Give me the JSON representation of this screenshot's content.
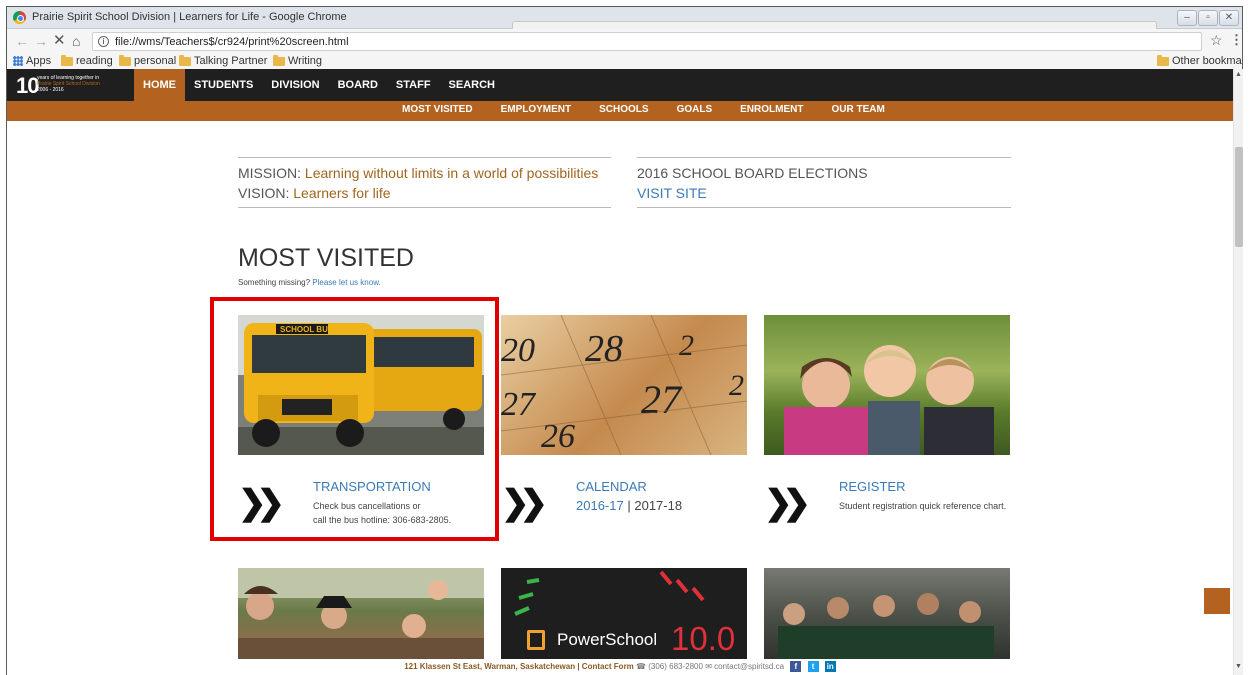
{
  "window": {
    "title": "Prairie Spirit School Division | Learners for Life - Google Chrome",
    "controls": {
      "minimize": "–",
      "maximize": "▫",
      "close": "✕"
    }
  },
  "toolbar": {
    "back": "←",
    "forward": "→",
    "reload": "✕",
    "home": "⌂",
    "url": "file://wms/Teachers$/cr924/print%20screen.html",
    "info": "i",
    "star": "☆",
    "menu": "⋮"
  },
  "bookmarks": {
    "items": [
      "Apps",
      "reading",
      "personal",
      "Talking Partner",
      "Writing"
    ],
    "other": "Other bookmarks"
  },
  "site": {
    "logo_number": "10",
    "logo_tagline": "years of learning together in",
    "logo_org": "Prairie Spirit School Division",
    "logo_years": "2006 - 2016",
    "main_nav": [
      "HOME",
      "STUDENTS",
      "DIVISION",
      "BOARD",
      "STAFF",
      "SEARCH"
    ],
    "sub_nav": [
      "MOST VISITED",
      "EMPLOYMENT",
      "SCHOOLS",
      "GOALS",
      "ENROLMENT",
      "OUR TEAM"
    ],
    "mission_label": "MISSION:",
    "mission_text": "Learning without limits in a world of possibilities",
    "vision_label": "VISION:",
    "vision_text": "Learners for life",
    "election_title": "2016 SCHOOL BOARD ELECTIONS",
    "election_link": "VISIT SITE",
    "most_visited_title": "MOST VISITED",
    "missing_text": "Something missing?",
    "missing_link": "Please let us know.",
    "arrow": "❯❯",
    "cards": {
      "transportation": {
        "title": "TRANSPORTATION",
        "line1": "Check bus cancellations or",
        "line2": "call the bus hotline: 306-683-2805."
      },
      "calendar": {
        "title": "CALENDAR",
        "link1": "2016-17",
        "sep": "|",
        "link2": "2017-18"
      },
      "register": {
        "title": "REGISTER",
        "desc": "Student registration quick reference chart."
      }
    },
    "powerschool_text": "PowerSchool",
    "powerschool_version": "10.0",
    "footer": {
      "address": "121 Klassen St East, Warman, Saskatchewan | Contact Form",
      "phone_icon": "☎",
      "phone": "(306) 683-2800",
      "mail_icon": "✉",
      "email": "contact@spiritsd.ca",
      "fb": "f",
      "tw": "t",
      "li": "in"
    }
  },
  "colors": {
    "accent": "#b4621f",
    "link": "#3a7ab8",
    "nav_bg": "#1f1f1f",
    "highlight": "#e00000"
  }
}
